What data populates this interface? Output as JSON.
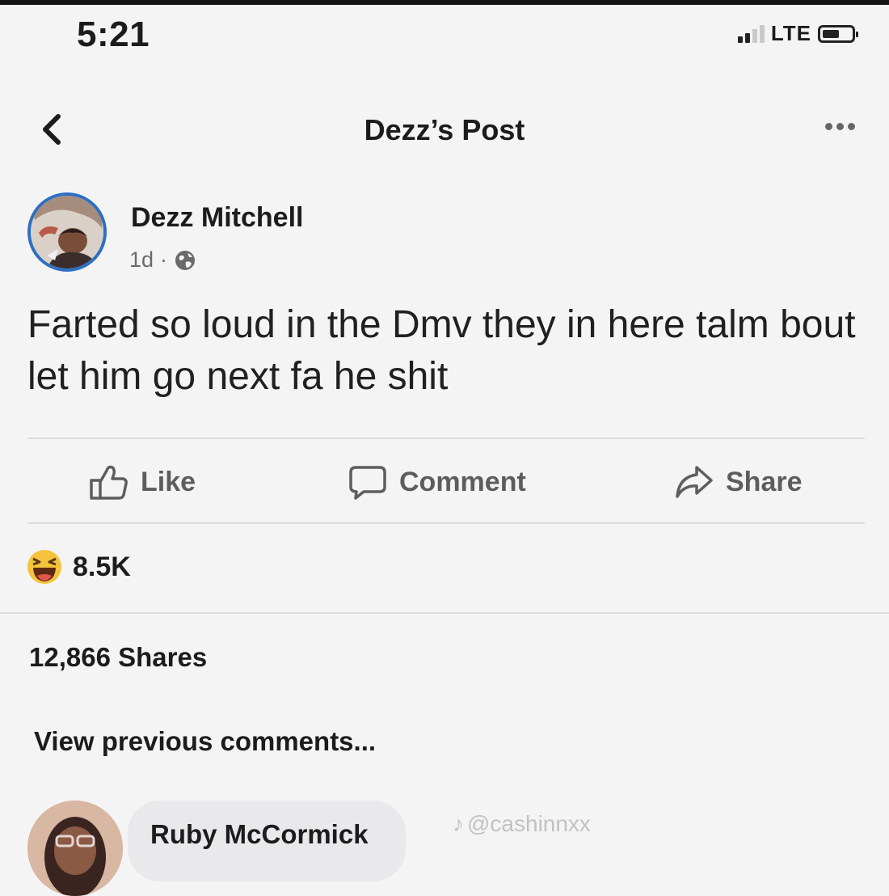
{
  "status_bar": {
    "time": "5:21",
    "network": "LTE",
    "signal_bars_active": 2,
    "signal_bars_total": 4,
    "battery_level": 0.6
  },
  "header": {
    "title": "Dezz’s Post",
    "back_icon": "chevron-left-icon",
    "more_icon": "more-horizontal-icon"
  },
  "post": {
    "author": "Dezz Mitchell",
    "time": "1d",
    "separator": "·",
    "privacy_icon": "globe-icon",
    "text": "Farted so loud in the Dmv they in here talm bout let him go next fa he shit"
  },
  "actions": {
    "like": "Like",
    "comment": "Comment",
    "share": "Share"
  },
  "reactions": {
    "icon": "laughing-face-icon",
    "count": "8.5K"
  },
  "shares_text": "12,866 Shares",
  "view_previous": "View previous comments...",
  "comment": {
    "author": "Ruby McCormick"
  },
  "watermark": "@cashinnxx",
  "colors": {
    "accent": "#2c6fc4",
    "action_text": "#5d5d5d",
    "background": "#f4f4f4"
  }
}
